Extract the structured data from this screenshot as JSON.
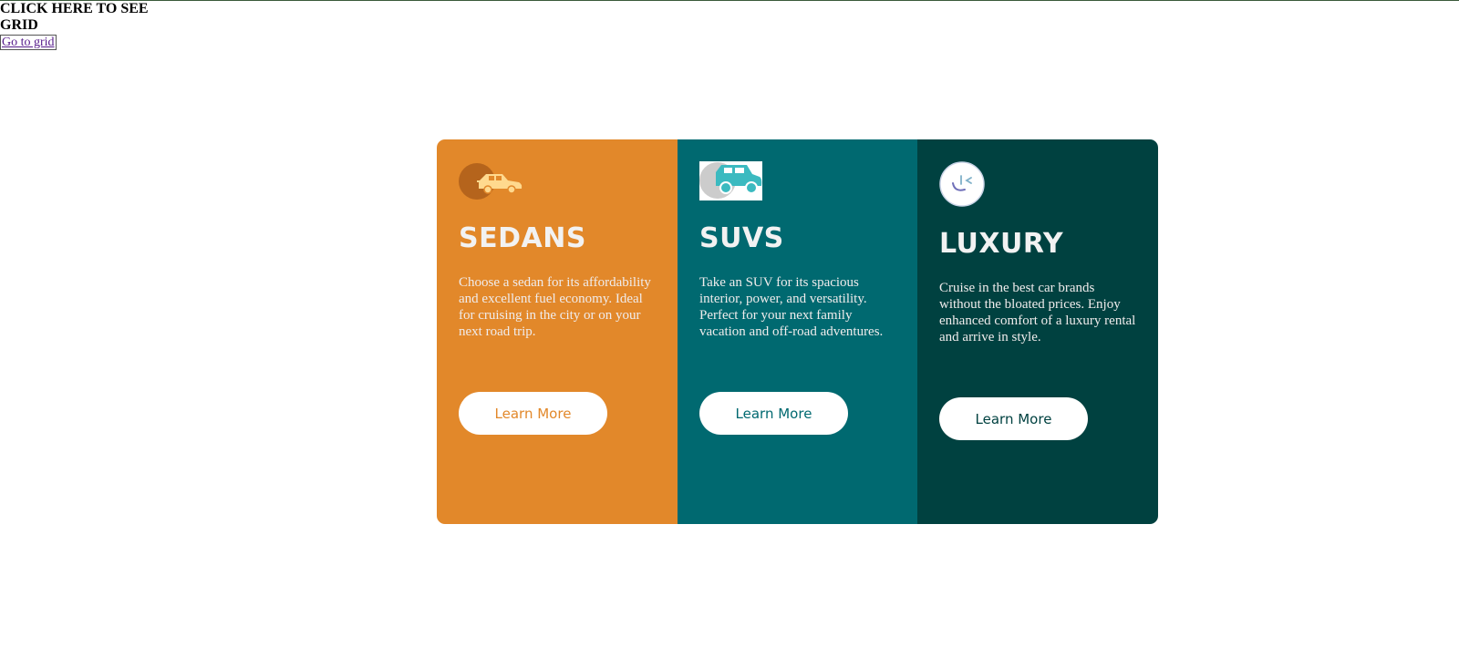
{
  "header": {
    "heading": "CLICK HERE TO SEE GRID",
    "link_label": "Go to grid"
  },
  "colors": {
    "sedans_bg": "#e2882a",
    "suvs_bg": "#006970",
    "luxury_bg": "#004140",
    "button_bg": "#ffffff",
    "title_text": "#f2f2f2"
  },
  "cards": [
    {
      "icon": "sedan-car-icon",
      "title": "SEDANS",
      "description": "Choose a sedan for its affordability and excellent fuel economy. Ideal for cruising in the city or on your next road trip.",
      "button_label": "Learn More"
    },
    {
      "icon": "suv-car-icon",
      "title": "SUVS",
      "description": "Take an SUV for its spacious interior, power, and versatility. Perfect for your next family vacation and off-road adventures.",
      "button_label": "Learn More"
    },
    {
      "icon": "luxury-car-icon",
      "title": "LUXURY",
      "description": "Cruise in the best car brands without the bloated prices. Enjoy enhanced comfort of a luxury rental and arrive in style.",
      "button_label": "Learn More"
    }
  ]
}
